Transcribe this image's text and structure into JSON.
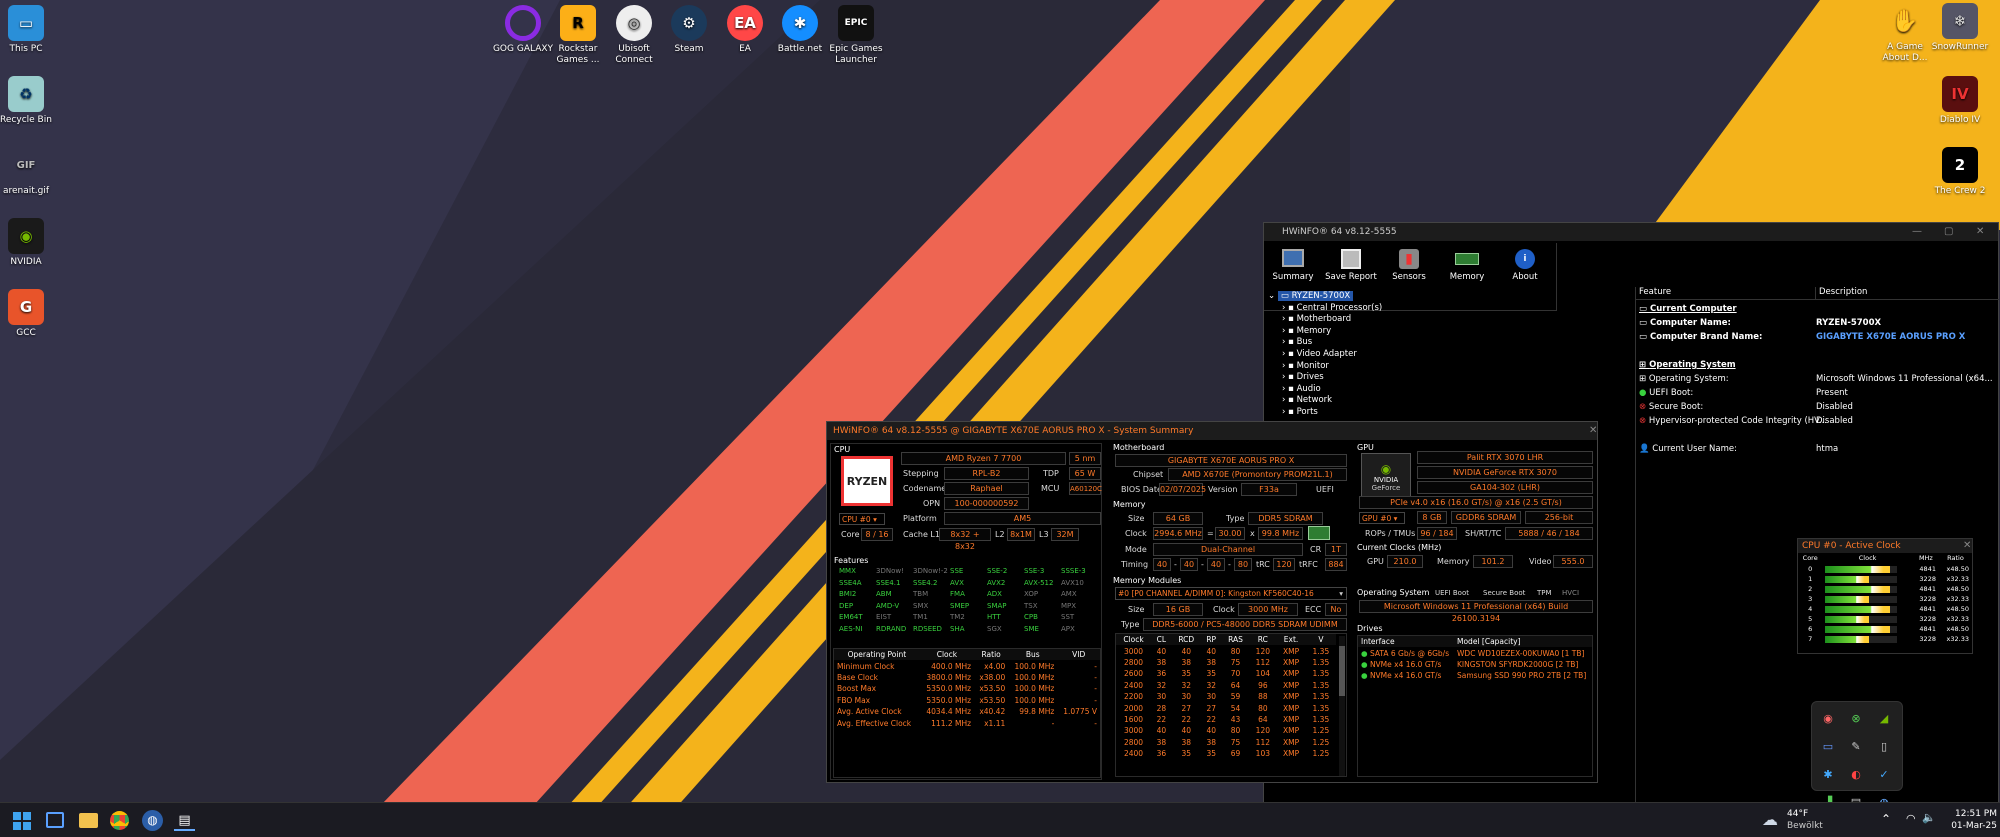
{
  "desktop_icons_left": [
    {
      "icon": "this-pc-icon",
      "label": "This PC"
    },
    {
      "icon": "recycle-bin-icon",
      "label": "Recycle Bin"
    },
    {
      "icon": "gif-file-icon",
      "label": "arenait.gif"
    },
    {
      "icon": "nvidia-icon",
      "label": "NVIDIA"
    },
    {
      "icon": "gcc-icon",
      "label": "GCC"
    }
  ],
  "desktop_icons_top": [
    {
      "icon": "gog-galaxy-icon",
      "label": "GOG GALAXY",
      "color": "#7a22c9"
    },
    {
      "icon": "rockstar-icon",
      "label": "Rockstar Games ...",
      "color": "#fcaf17"
    },
    {
      "icon": "ubisoft-icon",
      "label": "Ubisoft Connect",
      "color": "#1d1d2b"
    },
    {
      "icon": "steam-icon",
      "label": "Steam",
      "color": "#1b3a5b"
    },
    {
      "icon": "ea-icon",
      "label": "EA",
      "color": "#ff4747"
    },
    {
      "icon": "battlenet-icon",
      "label": "Battle.net",
      "color": "#148eff"
    },
    {
      "icon": "epic-games-icon",
      "label": "Epic Games Launcher",
      "color": "#111111"
    }
  ],
  "desktop_icons_right": [
    {
      "icon": "game-icon",
      "label": "A Game About D..."
    },
    {
      "icon": "snowrunner-icon",
      "label": "SnowRunner"
    },
    {
      "icon": "diablo-icon",
      "label": "Diablo IV"
    },
    {
      "icon": "crew-icon",
      "label": "The Crew 2"
    }
  ],
  "hwinfo_main": {
    "title": "HWiNFO® 64 v8.12-5555",
    "toolbar": [
      "Summary",
      "Save Report",
      "Sensors",
      "Memory",
      "About"
    ],
    "tree_root": "RYZEN-5700X",
    "tree": [
      "Central Processor(s)",
      "Motherboard",
      "Memory",
      "Bus",
      "Video Adapter",
      "Monitor",
      "Drives",
      "Audio",
      "Network",
      "Ports"
    ],
    "col_feature": "Feature",
    "col_description": "Description",
    "features": [
      {
        "type": "header",
        "feature": "Current Computer",
        "description": ""
      },
      {
        "type": "bold",
        "feature": "Computer Name:",
        "description": "RYZEN-5700X"
      },
      {
        "type": "bold",
        "feature": "Computer Brand Name:",
        "description": "GIGABYTE X670E AORUS PRO X"
      },
      {
        "type": "gap",
        "feature": "",
        "description": ""
      },
      {
        "type": "header",
        "feature": "Operating System",
        "description": ""
      },
      {
        "type": "item",
        "feature": "Operating System:",
        "description": "Microsoft Windows 11 Professional (x64..."
      },
      {
        "type": "ok",
        "feature": "UEFI Boot:",
        "description": "Present"
      },
      {
        "type": "bad",
        "feature": "Secure Boot:",
        "description": "Disabled"
      },
      {
        "type": "bad",
        "feature": "Hypervisor-protected Code Integrity (HV...",
        "description": "Disabled"
      },
      {
        "type": "gap",
        "feature": "",
        "description": ""
      },
      {
        "type": "item",
        "feature": "Current User Name:",
        "description": "htma"
      }
    ]
  },
  "summary": {
    "title": "HWiNFO® 64 v8.12-5555 @ GIGABYTE X670E AORUS PRO X - System Summary",
    "cpu": {
      "section": "CPU",
      "logo": "RYZEN",
      "name": "AMD Ryzen 7 7700",
      "nm": "5 nm",
      "stepping_label": "Stepping",
      "stepping": "RPL-B2",
      "tdp_label": "TDP",
      "tdp": "65 W",
      "codename_label": "Codename",
      "codename": "Raphael",
      "mcu_label": "MCU",
      "mcu": "A60120C",
      "opn_label": "OPN",
      "opn": "100-000000592",
      "select": "CPU #0",
      "platform_label": "Platform",
      "platform": "AM5",
      "core_label": "Core",
      "core": "8 / 16",
      "cache_label": "Cache L1",
      "cache": "8x32 + 8x32",
      "l2_label": "L2",
      "l2": "8x1M",
      "l3_label": "L3",
      "l3": "32M",
      "features_label": "Features",
      "features": [
        [
          "MMX",
          "3DNow!",
          "3DNow!-2",
          "SSE",
          "SSE-2",
          "SSE-3",
          "SSSE-3"
        ],
        [
          "SSE4A",
          "SSE4.1",
          "SSE4.2",
          "AVX",
          "AVX2",
          "AVX-512",
          "AVX10"
        ],
        [
          "BMI2",
          "ABM",
          "TBM",
          "FMA",
          "ADX",
          "XOP",
          "AMX"
        ],
        [
          "DEP",
          "AMD-V",
          "SMX",
          "SMEP",
          "SMAP",
          "TSX",
          "MPX"
        ],
        [
          "EM64T",
          "EIST",
          "TM1",
          "TM2",
          "HTT",
          "CPB",
          "SST"
        ],
        [
          "AES-NI",
          "RDRAND",
          "RDSEED",
          "SHA",
          "SGX",
          "SME",
          "APX"
        ]
      ],
      "features_on": [
        [
          1,
          0,
          0,
          1,
          1,
          1,
          1
        ],
        [
          1,
          1,
          1,
          1,
          1,
          1,
          0
        ],
        [
          1,
          1,
          0,
          1,
          1,
          0,
          0
        ],
        [
          1,
          1,
          0,
          1,
          1,
          0,
          0
        ],
        [
          1,
          0,
          0,
          0,
          1,
          1,
          0
        ],
        [
          1,
          1,
          1,
          1,
          0,
          1,
          0
        ]
      ],
      "op_headers": [
        "Operating Point",
        "Clock",
        "Ratio",
        "Bus",
        "VID"
      ],
      "op_rows": [
        [
          "Minimum Clock",
          "400.0 MHz",
          "x4.00",
          "100.0 MHz",
          "-"
        ],
        [
          "Base Clock",
          "3800.0 MHz",
          "x38.00",
          "100.0 MHz",
          "-"
        ],
        [
          "Boost Max",
          "5350.0 MHz",
          "x53.50",
          "100.0 MHz",
          "-"
        ],
        [
          "FBO Max",
          "5350.0 MHz",
          "x53.50",
          "100.0 MHz",
          "-"
        ],
        [
          "Avg. Active Clock",
          "4034.4 MHz",
          "x40.42",
          "99.8 MHz",
          "1.0775 V"
        ],
        [
          "Avg. Effective Clock",
          "111.2 MHz",
          "x1.11",
          "-",
          "-"
        ]
      ]
    },
    "mb": {
      "section": "Motherboard",
      "name": "GIGABYTE X670E AORUS PRO X",
      "chipset_label": "Chipset",
      "chipset": "AMD X670E (Promontory PROM21L.1)",
      "bios_label": "BIOS Date",
      "bios": "02/07/2025",
      "version_label": "Version",
      "version": "F33a",
      "uefi": "UEFI"
    },
    "mem": {
      "section": "Memory",
      "size_label": "Size",
      "size": "64 GB",
      "type_label": "Type",
      "type": "DDR5 SDRAM",
      "clock_label": "Clock",
      "clock": "2994.6 MHz",
      "eq": "=",
      "mult": "30.00",
      "x": "x",
      "bus": "99.8 MHz",
      "mode_label": "Mode",
      "mode": "Dual-Channel",
      "cr_label": "CR",
      "cr": "1T",
      "timing_label": "Timing",
      "timings": [
        "40",
        "40",
        "40",
        "80"
      ],
      "trc_label": "tRC",
      "trc": "120",
      "trfc_label": "tRFC",
      "trfc": "884",
      "modules_label": "Memory Modules",
      "module_select": "#0 [P0 CHANNEL A/DIMM 0]: Kingston KF560C40-16",
      "msize_label": "Size",
      "msize": "16 GB",
      "mclock_label": "Clock",
      "mclock": "3000 MHz",
      "ecc_label": "ECC",
      "ecc": "No",
      "mtype_label": "Type",
      "mtype": "DDR5-6000 / PC5-48000 DDR5 SDRAM UDIMM",
      "timing_headers": [
        "Clock",
        "CL",
        "RCD",
        "RP",
        "RAS",
        "RC",
        "Ext.",
        "V"
      ],
      "timing_rows": [
        [
          "3000",
          "40",
          "40",
          "40",
          "80",
          "120",
          "XMP",
          "1.35"
        ],
        [
          "2800",
          "38",
          "38",
          "38",
          "75",
          "112",
          "XMP",
          "1.35"
        ],
        [
          "2600",
          "36",
          "35",
          "35",
          "70",
          "104",
          "XMP",
          "1.35"
        ],
        [
          "2400",
          "32",
          "32",
          "32",
          "64",
          "96",
          "XMP",
          "1.35"
        ],
        [
          "2200",
          "30",
          "30",
          "30",
          "59",
          "88",
          "XMP",
          "1.35"
        ],
        [
          "2000",
          "28",
          "27",
          "27",
          "54",
          "80",
          "XMP",
          "1.35"
        ],
        [
          "1600",
          "22",
          "22",
          "22",
          "43",
          "64",
          "XMP",
          "1.35"
        ],
        [
          "3000",
          "40",
          "40",
          "40",
          "80",
          "120",
          "XMP",
          "1.25"
        ],
        [
          "2800",
          "38",
          "38",
          "38",
          "75",
          "112",
          "XMP",
          "1.25"
        ],
        [
          "2400",
          "36",
          "35",
          "35",
          "69",
          "103",
          "XMP",
          "1.25"
        ]
      ]
    },
    "gpu": {
      "section": "GPU",
      "logo_top": "NVIDIA",
      "logo_bottom": "GeForce",
      "brand": "Palit RTX 3070 LHR",
      "name": "NVIDIA GeForce RTX 3070",
      "chip": "GA104-302 (LHR)",
      "pcie": "PCIe v4.0 x16 (16.0 GT/s) @ x16 (2.5 GT/s)",
      "select": "GPU #0",
      "vram": "8 GB",
      "vtype": "GDDR6 SDRAM",
      "vbus": "256-bit",
      "rops_label": "ROPs / TMUs",
      "rops": "96 / 184",
      "sh_label": "SH/RT/TC",
      "sh": "5888 / 46 / 184",
      "clocks_label": "Current Clocks (MHz)",
      "gpu_label": "GPU",
      "gpu_clock": "210.0",
      "memory_label": "Memory",
      "memory_clock": "101.2",
      "video_label": "Video",
      "video_clock": "555.0"
    },
    "os": {
      "section": "Operating System",
      "flags": [
        "UEFI Boot",
        "Secure Boot",
        "TPM",
        "HVCI"
      ],
      "name": "Microsoft Windows 11 Professional (x64) Build 26100.3194"
    },
    "drives": {
      "section": "Drives",
      "headers": [
        "Interface",
        "Model [Capacity]"
      ],
      "rows": [
        [
          "SATA 6 Gb/s @ 6Gb/s",
          "WDC WD10EZEX-00KUWA0 [1 TB]"
        ],
        [
          "NVMe x4 16.0 GT/s",
          "KINGSTON SFYRDK2000G [2 TB]"
        ],
        [
          "NVMe x4 16.0 GT/s",
          "Samsung SSD 990 PRO 2TB [2 TB]"
        ]
      ]
    }
  },
  "active_clock": {
    "title": "CPU #0 - Active Clock",
    "headers": [
      "Core",
      "Clock",
      "MHz",
      "Ratio"
    ],
    "rows": [
      {
        "core": "0",
        "mhz": "4841",
        "ratio": "x48.50",
        "level": 0.9
      },
      {
        "core": "1",
        "mhz": "3228",
        "ratio": "x32.33",
        "level": 0.6
      },
      {
        "core": "2",
        "mhz": "4841",
        "ratio": "x48.50",
        "level": 0.9
      },
      {
        "core": "3",
        "mhz": "3228",
        "ratio": "x32.33",
        "level": 0.6
      },
      {
        "core": "4",
        "mhz": "4841",
        "ratio": "x48.50",
        "level": 0.9
      },
      {
        "core": "5",
        "mhz": "3228",
        "ratio": "x32.33",
        "level": 0.6
      },
      {
        "core": "6",
        "mhz": "4841",
        "ratio": "x48.50",
        "level": 0.9
      },
      {
        "core": "7",
        "mhz": "3228",
        "ratio": "x32.33",
        "level": 0.6
      }
    ]
  },
  "taskbar": {
    "weather_temp": "44°F",
    "weather_desc": "Bewölkt",
    "time": "12:51 PM",
    "date": "01-Mar-25"
  }
}
